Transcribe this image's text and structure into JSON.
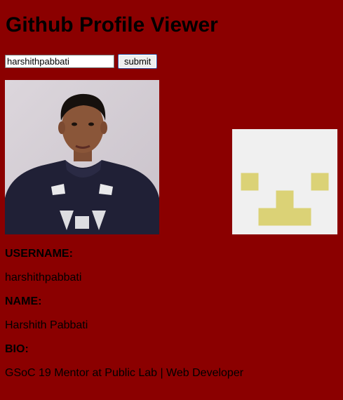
{
  "app": {
    "title": "Github Profile Viewer"
  },
  "search": {
    "value": "harshithpabbati",
    "submit_label": "submit"
  },
  "profile": {
    "avatar_icon": "profile-photo",
    "identicon_icon": "identicon",
    "identicon_colors": {
      "background": "#f0f0f0",
      "foreground": "#dbd276"
    },
    "username_label": "USERNAME:",
    "username": "harshithpabbati",
    "name_label": "NAME:",
    "name": "Harshith Pabbati",
    "bio_label": "BIO:",
    "bio": "GSoC 19 Mentor at Public Lab | Web Developer"
  },
  "theme": {
    "background": "#8b0000"
  }
}
